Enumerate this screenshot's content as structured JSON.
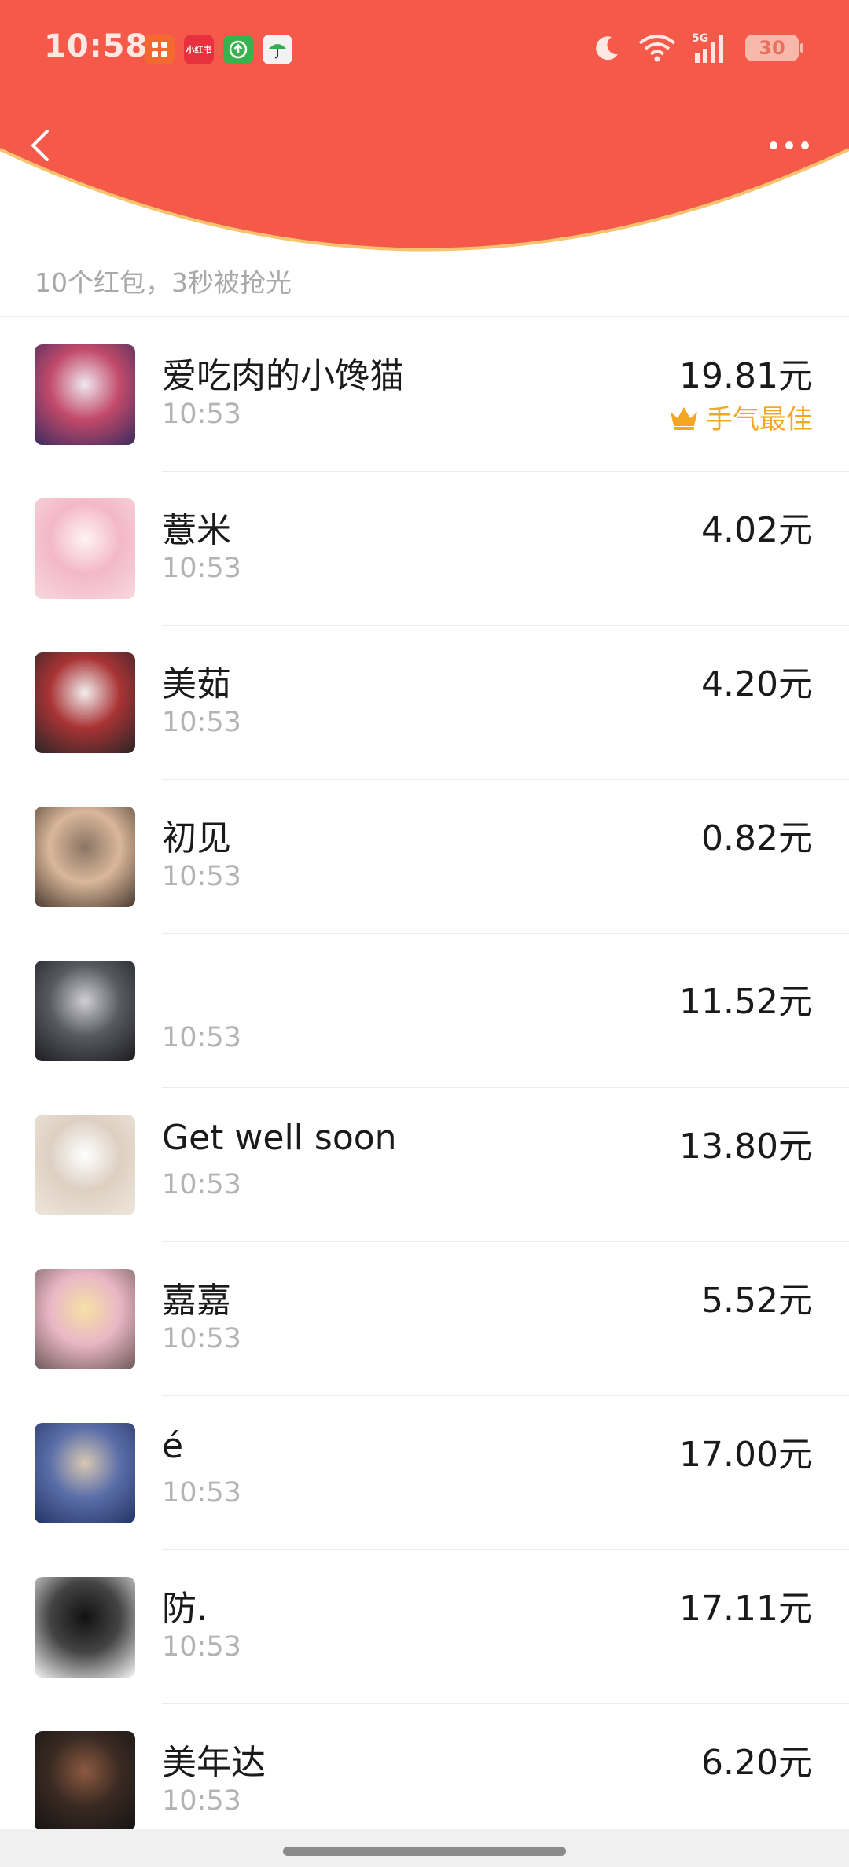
{
  "colors": {
    "header_red": "#f4594a",
    "header_edge": "#f6c36f",
    "gold": "#f5a623"
  },
  "status_bar": {
    "time": "10:58",
    "apps": [
      {
        "label": "",
        "icon": "app-grid-icon",
        "bg": "#f4692f"
      },
      {
        "label": "小红书",
        "icon": "xiaohongshu-icon",
        "bg": "#e8313f"
      },
      {
        "label": "",
        "icon": "upload-icon",
        "bg": "#37b24d"
      },
      {
        "label": "",
        "icon": "umbrella-icon",
        "bg": "#f2f2f2"
      }
    ],
    "network": "5G",
    "battery": "30"
  },
  "header": {
    "back_icon": "back-chevron-icon",
    "more_icon": "more-dots-icon"
  },
  "summary": "10个红包，3秒被抢光",
  "best_luck_label": "手气最佳",
  "records": [
    {
      "name": "爱吃肉的小馋猫",
      "time": "10:53",
      "amount": "19.81元",
      "best": true,
      "avatar_colors": [
        "#3b2b5e",
        "#c24a6a",
        "#efe7ef"
      ]
    },
    {
      "name": "薏米",
      "time": "10:53",
      "amount": "4.02元",
      "best": false,
      "avatar_colors": [
        "#f7d8df",
        "#f3b8c8",
        "#fff3f5"
      ]
    },
    {
      "name": "美茹",
      "time": "10:53",
      "amount": "4.20元",
      "best": false,
      "avatar_colors": [
        "#2a2526",
        "#a93335",
        "#f2eeee"
      ]
    },
    {
      "name": "初见",
      "time": "10:53",
      "amount": "0.82元",
      "best": false,
      "avatar_colors": [
        "#4a3a30",
        "#d9b79a",
        "#8a7565"
      ]
    },
    {
      "name": "",
      "time": "10:53",
      "amount": "11.52元",
      "best": false,
      "avatar_colors": [
        "#1c1c1f",
        "#585a62",
        "#cfcfd4"
      ]
    },
    {
      "name": "Get well soon",
      "time": "10:53",
      "amount": "13.80元",
      "best": false,
      "avatar_colors": [
        "#efe6dc",
        "#ddd0c2",
        "#ffffff"
      ]
    },
    {
      "name": "嘉嘉",
      "time": "10:53",
      "amount": "5.52元",
      "best": false,
      "avatar_colors": [
        "#6e5a57",
        "#e9b6c6",
        "#f6e1a6"
      ]
    },
    {
      "name": "é",
      "time": "10:53",
      "amount": "17.00元",
      "best": false,
      "avatar_colors": [
        "#243466",
        "#5b6ea8",
        "#d8c8b4"
      ]
    },
    {
      "name": "防.",
      "time": "10:53",
      "amount": "17.11元",
      "best": false,
      "avatar_colors": [
        "#f5f5f5",
        "#444444",
        "#111111"
      ]
    },
    {
      "name": "美年达",
      "time": "10:53",
      "amount": "6.20元",
      "best": false,
      "avatar_colors": [
        "#141414",
        "#3a2a22",
        "#8c5a40"
      ]
    }
  ]
}
